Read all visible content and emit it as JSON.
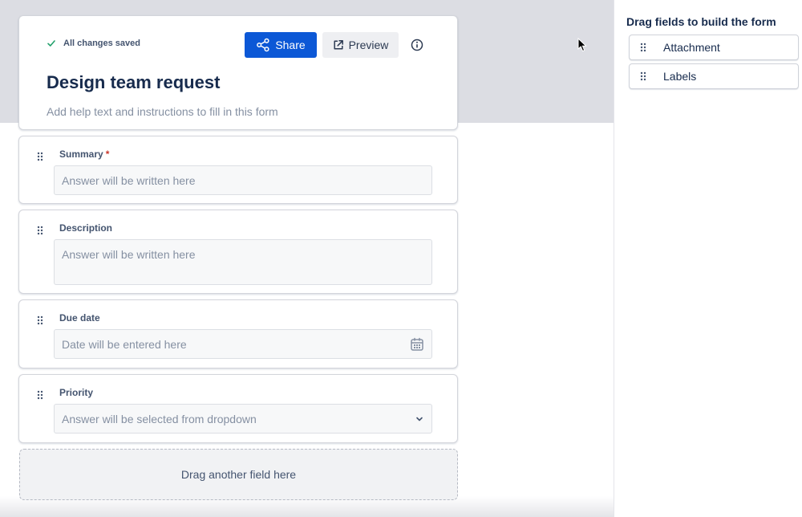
{
  "header": {
    "saved_status": "All changes saved",
    "share_label": "Share",
    "preview_label": "Preview",
    "title": "Design team request",
    "help_placeholder": "Add help text and instructions to fill in this form"
  },
  "fields": [
    {
      "label": "Summary",
      "required": true,
      "placeholder": "Answer will be written here",
      "type": "text"
    },
    {
      "label": "Description",
      "required": false,
      "placeholder": "Answer will be written here",
      "type": "paragraph"
    },
    {
      "label": "Due date",
      "required": false,
      "placeholder": "Date will be entered here",
      "type": "date"
    },
    {
      "label": "Priority",
      "required": false,
      "placeholder": "Answer will be selected from dropdown",
      "type": "dropdown"
    }
  ],
  "required_marker": "*",
  "drop_zone": {
    "label": "Drag another field here"
  },
  "palette": {
    "title": "Drag fields to build the form",
    "items": [
      {
        "label": "Attachment"
      },
      {
        "label": "Labels"
      }
    ]
  },
  "icons": {
    "saved": "check-icon",
    "share": "share-icon",
    "preview": "external-link-icon",
    "info": "info-icon",
    "grip": "drag-handle-icon",
    "date": "calendar-icon",
    "dropdown": "chevron-down-icon"
  },
  "colors": {
    "primary": "#0c58d6",
    "success": "#22a06b",
    "required": "#c9372c",
    "text": "#172b4d",
    "subtle_text": "#8590a2",
    "backdrop": "#dcdde3"
  }
}
